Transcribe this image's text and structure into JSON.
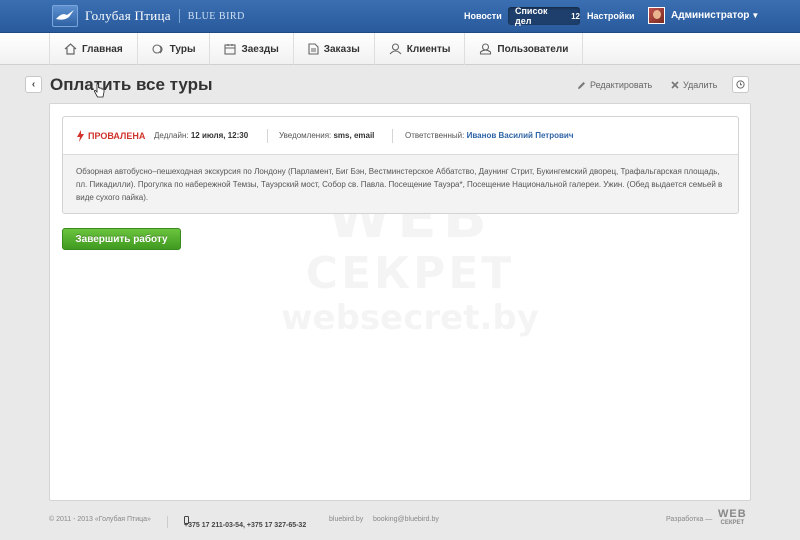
{
  "topbar": {
    "logo_ru": "Голубая Птица",
    "logo_en": "BLUE BIRD",
    "news": "Новости",
    "todo_label": "Список дел",
    "todo_count": "12",
    "settings": "Настройки",
    "user": "Администратор"
  },
  "nav": {
    "items": [
      {
        "label": "Главная",
        "icon": "home-icon"
      },
      {
        "label": "Туры",
        "icon": "tours-icon"
      },
      {
        "label": "Заезды",
        "icon": "calendar-icon"
      },
      {
        "label": "Заказы",
        "icon": "orders-icon"
      },
      {
        "label": "Клиенты",
        "icon": "client-icon"
      },
      {
        "label": "Пользователи",
        "icon": "users-icon"
      }
    ]
  },
  "page": {
    "title": "Оплатить все туры",
    "edit_label": "Редактировать",
    "delete_label": "Удалить"
  },
  "task": {
    "status": "ПРОВАЛЕНА",
    "status_color": "#d0342c",
    "deadline_label": "Дедлайн:",
    "deadline_value": "12 июля, 12:30",
    "notify_label": "Уведомления:",
    "notify_value": "sms, email",
    "responsible_label": "Ответственный:",
    "responsible_value": "Иванов Василий Петрович",
    "description": "Обзорная автобусно–пешеходная экскурсия по Лондону (Парламент, Биг Бэн, Вестминстерское Аббатство, Даунинг Стрит, Букингемский дворец, Трафальгарская площадь, пл. Пикадилли). Прогулка по набережной Темзы, Тауэрский мост, Собор св. Павла. Посещение Тауэра*, Посещение  Национальной галереи. Ужин. (Обед выдается семьей в виде сухого пайка).",
    "finish_button": "Завершить работу"
  },
  "watermark": {
    "line1": "WEB",
    "line2": "СЕКРЕТ",
    "line3": "websecret.by"
  },
  "footer": {
    "copyright": "© 2011 - 2013 «Голубая Птица»",
    "phones": "+375 17 211-03-54, +375 17 327-65-32",
    "site": "bluebird.by",
    "email": "booking@bluebird.by",
    "dev_label": "Разработка —",
    "dev_logo_top": "WEB",
    "dev_logo_bottom": "СЕКРЕТ"
  }
}
